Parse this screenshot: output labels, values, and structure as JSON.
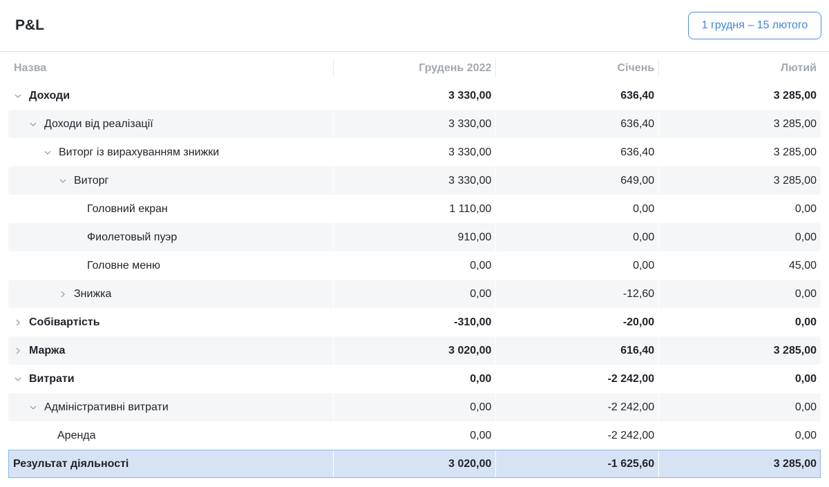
{
  "header": {
    "title": "P&L",
    "date_range": "1 грудня – 15 лютого"
  },
  "table": {
    "columns": [
      "Назва",
      "Грудень 2022",
      "Січень",
      "Лютий"
    ],
    "rows": [
      {
        "name": "Доходи",
        "values": [
          "3 330,00",
          "636,40",
          "3 285,00"
        ]
      },
      {
        "name": "Доходи від реалізації",
        "values": [
          "3 330,00",
          "636,40",
          "3 285,00"
        ]
      },
      {
        "name": "Виторг із вирахуванням знижки",
        "values": [
          "3 330,00",
          "636,40",
          "3 285,00"
        ]
      },
      {
        "name": "Виторг",
        "values": [
          "3 330,00",
          "649,00",
          "3 285,00"
        ]
      },
      {
        "name": "Головний екран",
        "values": [
          "1 110,00",
          "0,00",
          "0,00"
        ]
      },
      {
        "name": "Фиолетовый пуэр",
        "values": [
          "910,00",
          "0,00",
          "0,00"
        ]
      },
      {
        "name": "Головне меню",
        "values": [
          "0,00",
          "0,00",
          "45,00"
        ]
      },
      {
        "name": "Знижка",
        "values": [
          "0,00",
          "-12,60",
          "0,00"
        ]
      },
      {
        "name": "Собівартість",
        "values": [
          "-310,00",
          "-20,00",
          "0,00"
        ]
      },
      {
        "name": "Маржа",
        "values": [
          "3 020,00",
          "616,40",
          "3 285,00"
        ]
      },
      {
        "name": "Витрати",
        "values": [
          "0,00",
          "-2 242,00",
          "0,00"
        ]
      },
      {
        "name": "Адміністративні витрати",
        "values": [
          "0,00",
          "-2 242,00",
          "0,00"
        ]
      },
      {
        "name": "Аренда",
        "values": [
          "0,00",
          "-2 242,00",
          "0,00"
        ]
      },
      {
        "name": "Результат діяльності",
        "values": [
          "3 020,00",
          "-1 625,60",
          "3 285,00"
        ]
      }
    ]
  },
  "icons": {
    "expanded": "chevron-down-icon",
    "collapsed": "chevron-right-icon"
  },
  "colors": {
    "accent": "#4a90e2",
    "row_shade": "#f5f6f8",
    "result_row": "#d5e3f5"
  }
}
